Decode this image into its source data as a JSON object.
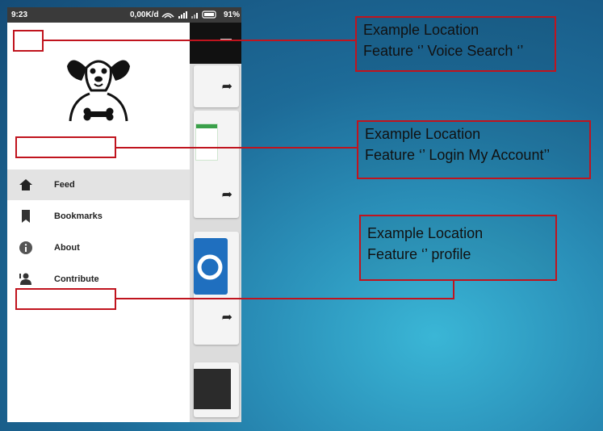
{
  "status_bar": {
    "time": "9:23",
    "speed": "0,00K/d",
    "battery": "91%"
  },
  "drawer": {
    "menu_items": [
      {
        "label": "Feed",
        "icon": "home-icon",
        "active": true
      },
      {
        "label": "Bookmarks",
        "icon": "bookmark-icon",
        "active": false
      },
      {
        "label": "About",
        "icon": "info-icon",
        "active": false
      },
      {
        "label": "Contribute",
        "icon": "contribute-icon",
        "active": false
      }
    ]
  },
  "callouts": [
    {
      "line1": "Example Location",
      "line2": "Feature ‘’ Voice Search ‘’"
    },
    {
      "line1": "Example Location",
      "line2": "Feature ‘’ Login My Account’’"
    },
    {
      "line1": "Example Location",
      "line2": "Feature ‘’ profile"
    }
  ],
  "colors": {
    "annotation_red": "#c0141e",
    "drawer_active": "#e3e3e3",
    "status_bar": "#3a3a3a"
  }
}
